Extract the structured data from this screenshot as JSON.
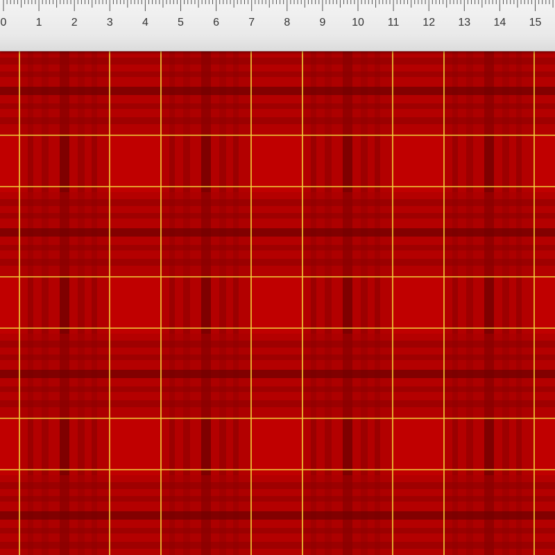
{
  "ruler": {
    "labels": [
      "0",
      "1",
      "2",
      "3",
      "4",
      "5",
      "6",
      "7",
      "8",
      "9",
      "10",
      "11",
      "12",
      "13",
      "14",
      "15"
    ]
  },
  "fabric": {
    "pattern": "red tartan plaid",
    "colors": {
      "base": "#c00000",
      "mid": "#a80000",
      "dark": "#8a0000",
      "darkest": "#6e0000",
      "accent_line": "#f2d23a"
    }
  }
}
